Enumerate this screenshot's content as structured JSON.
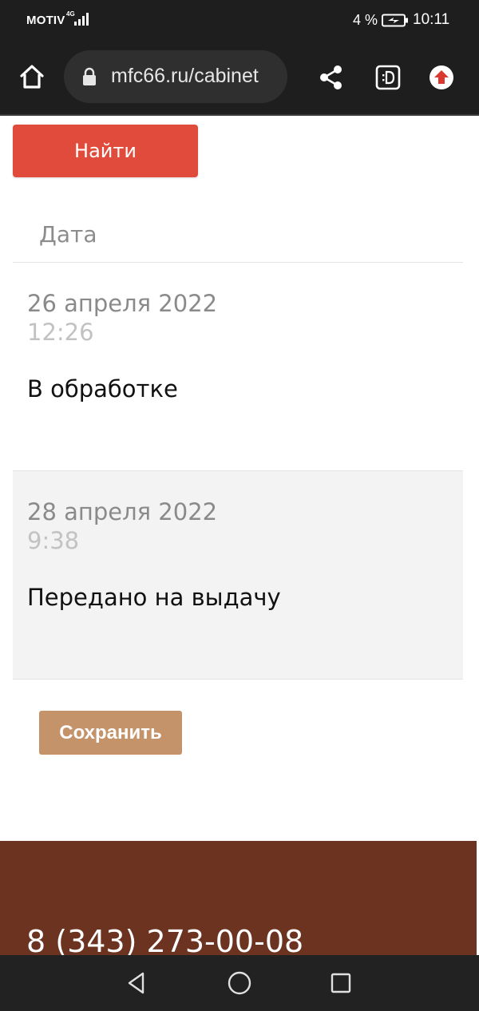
{
  "status_bar": {
    "carrier": "MOTIV",
    "network": "4G",
    "battery_percent": "4 %",
    "time": "10:11"
  },
  "browser": {
    "url": "mfc66.ru/cabinet",
    "icons": [
      "home-icon",
      "lock-icon",
      "share-icon",
      "tab-switcher-icon",
      "update-icon"
    ]
  },
  "content": {
    "find_button": "Найти",
    "date_header": "Дата",
    "history": [
      {
        "date": "26 апреля 2022",
        "time": "12:26",
        "status": "В обработке"
      },
      {
        "date": "28 апреля 2022",
        "time": "9:38",
        "status": "Передано на выдачу"
      }
    ],
    "save_button": "Сохранить"
  },
  "footer": {
    "phone": "8 (343) 273-00-08"
  },
  "nav_bar": {
    "icons": [
      "back-icon",
      "home-icon",
      "recents-icon"
    ]
  },
  "colors": {
    "find_button": "#e04b3c",
    "save_button": "#c4936a",
    "footer_background": "#6b3320",
    "system_bar": "#1e1e1e"
  }
}
